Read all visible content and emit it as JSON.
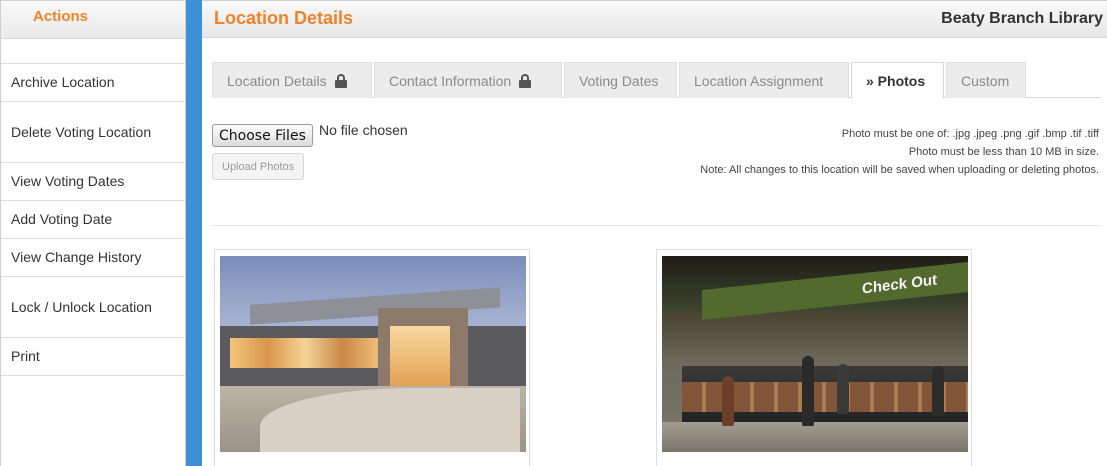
{
  "sidebar": {
    "title": "Actions",
    "items": [
      {
        "label": "Archive Location"
      },
      {
        "label": "Delete Voting Location"
      },
      {
        "label": "View Voting Dates"
      },
      {
        "label": "Add Voting Date"
      },
      {
        "label": "View Change History"
      },
      {
        "label": "Lock / Unlock Location"
      },
      {
        "label": "Print"
      }
    ]
  },
  "header": {
    "title": "Location Details",
    "branch": "Beaty Branch Library"
  },
  "tabs": [
    {
      "label": "Location Details",
      "locked": true
    },
    {
      "label": "Contact Information",
      "locked": true
    },
    {
      "label": "Voting Dates",
      "locked": false
    },
    {
      "label": "Location Assignment",
      "locked": false
    },
    {
      "label": "» Photos",
      "locked": false,
      "active": true
    },
    {
      "label": "Custom",
      "locked": false
    }
  ],
  "upload": {
    "choose_label": "Choose Files",
    "no_file": "No file chosen",
    "upload_label": "Upload Photos",
    "note_formats": "Photo must be one of: .jpg .jpeg .png .gif .bmp .tif .tiff",
    "note_size": "Photo must be less than 10 MB in size.",
    "note_save": "Note: All changes to this location will be saved when uploading or deleting photos."
  },
  "photos": [
    {
      "subject": "library-exterior"
    },
    {
      "subject": "checkout-desk",
      "sign_text": "Check Out"
    }
  ],
  "colors": {
    "accent": "#f0822a",
    "divider": "#3d8fd6"
  }
}
